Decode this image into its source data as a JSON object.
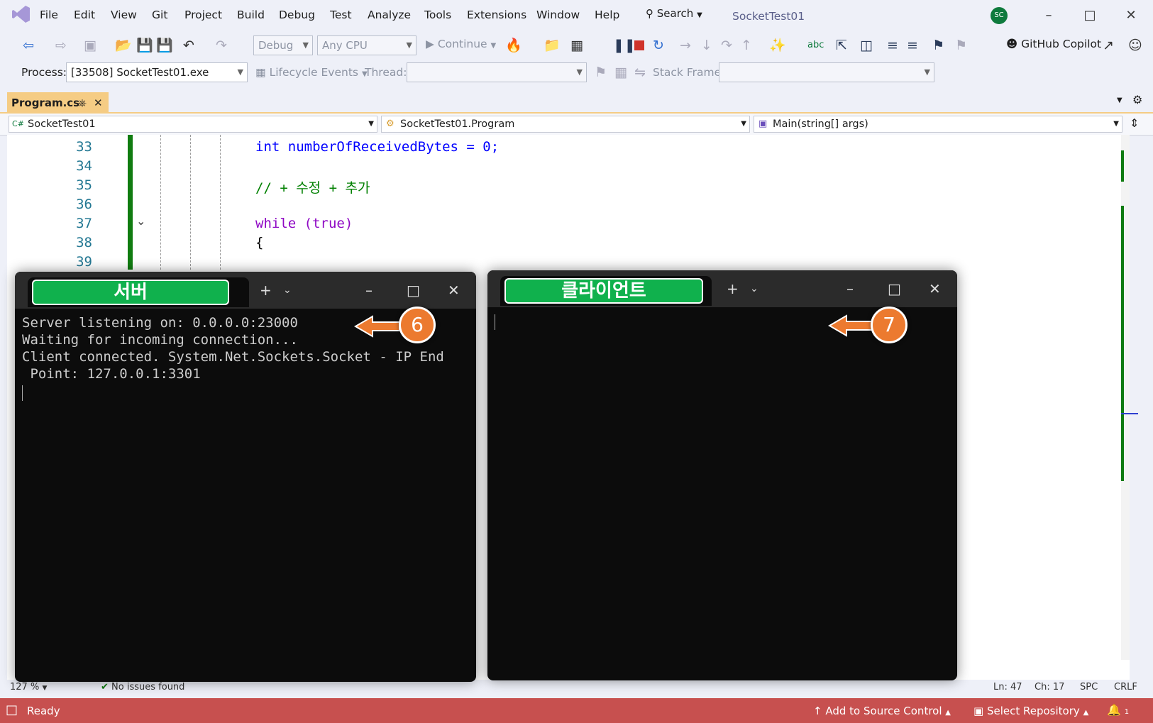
{
  "menu": {
    "items": [
      "File",
      "Edit",
      "View",
      "Git",
      "Project",
      "Build",
      "Debug",
      "Test",
      "Analyze",
      "Tools",
      "Extensions",
      "Window",
      "Help"
    ],
    "search_label": "Search",
    "solution_name": "SocketTest01",
    "avatar_initials": "SC"
  },
  "toolbar": {
    "config": "Debug",
    "platform": "Any CPU",
    "continue_label": "Continue",
    "copilot_label": "GitHub Copilot"
  },
  "debug_location": {
    "process_label": "Process:",
    "process_value": "[33508] SocketTest01.exe",
    "lifecycle_label": "Lifecycle Events",
    "thread_label": "Thread:",
    "stackframe_label": "Stack Frame:"
  },
  "document_tab": {
    "name": "Program.cs"
  },
  "navbar": {
    "project": "SocketTest01",
    "type": "SocketTest01.Program",
    "member": "Main(string[] args)"
  },
  "code_lines": [
    {
      "n": "33",
      "text": "int numberOfReceivedBytes = 0;"
    },
    {
      "n": "34",
      "text": ""
    },
    {
      "n": "35",
      "text": "// + 수정 + 추가"
    },
    {
      "n": "36",
      "text": ""
    },
    {
      "n": "37",
      "text": "while (true)"
    },
    {
      "n": "38",
      "text": "{"
    },
    {
      "n": "39",
      "text": ""
    }
  ],
  "editor_status": {
    "zoom": "127 %",
    "issues": "No issues found",
    "ln": "Ln: 47",
    "ch": "Ch: 17",
    "spc": "SPC",
    "crlf": "CRLF"
  },
  "statusbar": {
    "ready": "Ready",
    "add_source": "Add to Source Control",
    "select_repo": "Select Repository",
    "notifications": "1"
  },
  "server_terminal": {
    "tab_label": "서버",
    "lines": [
      "Server listening on: 0.0.0.0:23000",
      "Waiting for incoming connection...",
      "Client connected. System.Net.Sockets.Socket - IP End",
      " Point: 127.0.0.1:3301"
    ],
    "callout": "6"
  },
  "client_terminal": {
    "tab_label": "클라이언트",
    "callout": "7"
  },
  "colors": {
    "status_red": "#c7504f",
    "tab_gold": "#f5cc84",
    "label_green": "#10b14d",
    "callout_orange": "#ec7a2f"
  }
}
